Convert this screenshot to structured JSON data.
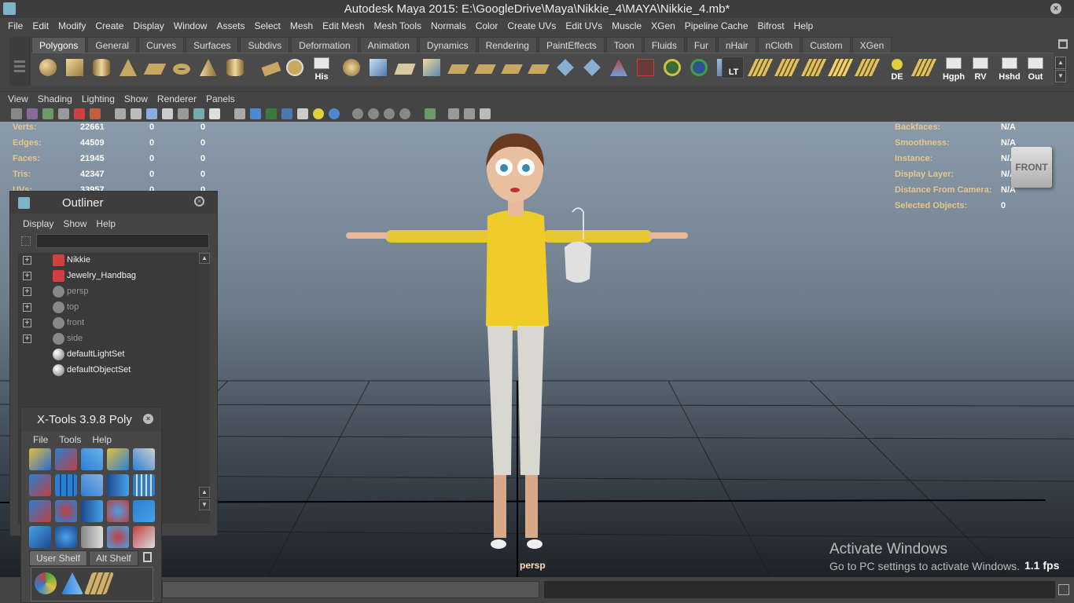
{
  "window": {
    "title": "Autodesk Maya 2015: E:\\GoogleDrive\\Maya\\Nikkie_4\\MAYA\\Nikkie_4.mb*"
  },
  "menubar": [
    "File",
    "Edit",
    "Modify",
    "Create",
    "Display",
    "Window",
    "Assets",
    "Select",
    "Mesh",
    "Edit Mesh",
    "Mesh Tools",
    "Normals",
    "Color",
    "Create UVs",
    "Edit UVs",
    "Muscle",
    "XGen",
    "Pipeline Cache",
    "Bifrost",
    "Help"
  ],
  "shelf_tabs": [
    "Polygons",
    "General",
    "Curves",
    "Surfaces",
    "Subdivs",
    "Deformation",
    "Animation",
    "Dynamics",
    "Rendering",
    "PaintEffects",
    "Toon",
    "Fluids",
    "Fur",
    "nHair",
    "nCloth",
    "Custom",
    "XGen"
  ],
  "shelf_active_tab": "Polygons",
  "shelf_labels": {
    "his": "His",
    "lt": "LT",
    "de": "DE",
    "hgph": "Hgph",
    "rv": "RV",
    "hshd": "Hshd",
    "out": "Out"
  },
  "panel_menu": [
    "View",
    "Shading",
    "Lighting",
    "Show",
    "Renderer",
    "Panels"
  ],
  "hud_left": [
    {
      "label": "Verts:",
      "v1": "22661",
      "v2": "0",
      "v3": "0"
    },
    {
      "label": "Edges:",
      "v1": "44509",
      "v2": "0",
      "v3": "0"
    },
    {
      "label": "Faces:",
      "v1": "21945",
      "v2": "0",
      "v3": "0"
    },
    {
      "label": "Tris:",
      "v1": "42347",
      "v2": "0",
      "v3": "0"
    },
    {
      "label": "UVs:",
      "v1": "33957",
      "v2": "0",
      "v3": "0"
    }
  ],
  "hud_right": [
    {
      "label": "Backfaces:",
      "value": "N/A"
    },
    {
      "label": "Smoothness:",
      "value": "N/A"
    },
    {
      "label": "Instance:",
      "value": "N/A"
    },
    {
      "label": "Display Layer:",
      "value": "N/A"
    },
    {
      "label": "Distance From Camera:",
      "value": "N/A"
    },
    {
      "label": "Selected Objects:",
      "value": "0"
    }
  ],
  "viewcube_label": "FRONT",
  "camera_label": "persp",
  "fps": "1.1 fps",
  "activate": {
    "line1": "Activate Windows",
    "line2": "Go to PC settings to activate Windows."
  },
  "outliner": {
    "title": "Outliner",
    "menu": [
      "Display",
      "Show",
      "Help"
    ],
    "items": [
      {
        "name": "Nikkie",
        "expandable": true,
        "dim": false,
        "icon": "mesh-icon"
      },
      {
        "name": "Jewelry_Handbag",
        "expandable": true,
        "dim": false,
        "icon": "mesh-icon"
      },
      {
        "name": "persp",
        "expandable": true,
        "dim": true,
        "icon": "camera-icon"
      },
      {
        "name": "top",
        "expandable": true,
        "dim": true,
        "icon": "camera-icon"
      },
      {
        "name": "front",
        "expandable": true,
        "dim": true,
        "icon": "camera-icon"
      },
      {
        "name": "side",
        "expandable": true,
        "dim": true,
        "icon": "camera-icon"
      },
      {
        "name": "defaultLightSet",
        "expandable": false,
        "dim": false,
        "icon": "set-icon"
      },
      {
        "name": "defaultObjectSet",
        "expandable": false,
        "dim": false,
        "icon": "set-icon"
      }
    ]
  },
  "xtools": {
    "title": "X-Tools 3.9.8 Poly",
    "menu": [
      "File",
      "Tools",
      "Help"
    ],
    "tabs": [
      "User Shelf",
      "Alt Shelf"
    ]
  },
  "colors": {
    "hud_label": "#e8c68a",
    "accent_blue": "#2a7fd4",
    "shirt": "#f0c820"
  }
}
